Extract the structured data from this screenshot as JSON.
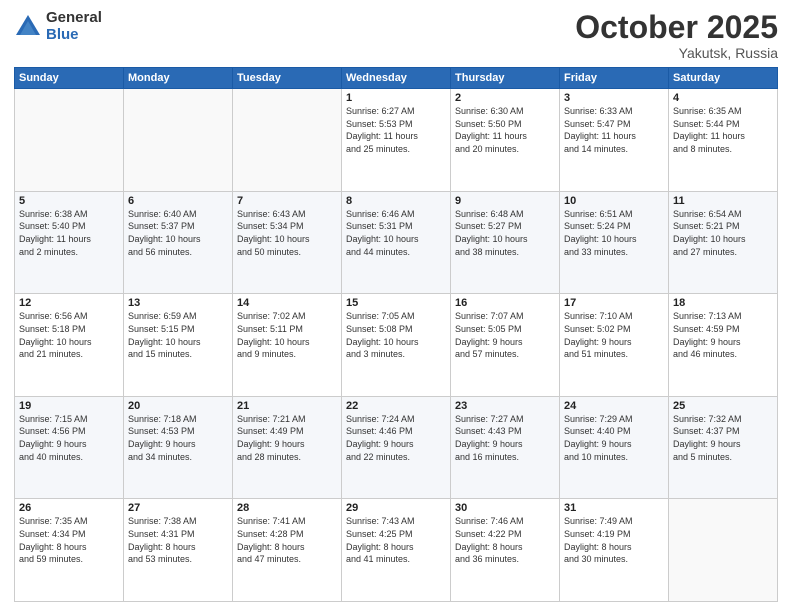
{
  "header": {
    "logo_general": "General",
    "logo_blue": "Blue",
    "month": "October 2025",
    "location": "Yakutsk, Russia"
  },
  "days_of_week": [
    "Sunday",
    "Monday",
    "Tuesday",
    "Wednesday",
    "Thursday",
    "Friday",
    "Saturday"
  ],
  "weeks": [
    [
      {
        "day": "",
        "info": ""
      },
      {
        "day": "",
        "info": ""
      },
      {
        "day": "",
        "info": ""
      },
      {
        "day": "1",
        "info": "Sunrise: 6:27 AM\nSunset: 5:53 PM\nDaylight: 11 hours\nand 25 minutes."
      },
      {
        "day": "2",
        "info": "Sunrise: 6:30 AM\nSunset: 5:50 PM\nDaylight: 11 hours\nand 20 minutes."
      },
      {
        "day": "3",
        "info": "Sunrise: 6:33 AM\nSunset: 5:47 PM\nDaylight: 11 hours\nand 14 minutes."
      },
      {
        "day": "4",
        "info": "Sunrise: 6:35 AM\nSunset: 5:44 PM\nDaylight: 11 hours\nand 8 minutes."
      }
    ],
    [
      {
        "day": "5",
        "info": "Sunrise: 6:38 AM\nSunset: 5:40 PM\nDaylight: 11 hours\nand 2 minutes."
      },
      {
        "day": "6",
        "info": "Sunrise: 6:40 AM\nSunset: 5:37 PM\nDaylight: 10 hours\nand 56 minutes."
      },
      {
        "day": "7",
        "info": "Sunrise: 6:43 AM\nSunset: 5:34 PM\nDaylight: 10 hours\nand 50 minutes."
      },
      {
        "day": "8",
        "info": "Sunrise: 6:46 AM\nSunset: 5:31 PM\nDaylight: 10 hours\nand 44 minutes."
      },
      {
        "day": "9",
        "info": "Sunrise: 6:48 AM\nSunset: 5:27 PM\nDaylight: 10 hours\nand 38 minutes."
      },
      {
        "day": "10",
        "info": "Sunrise: 6:51 AM\nSunset: 5:24 PM\nDaylight: 10 hours\nand 33 minutes."
      },
      {
        "day": "11",
        "info": "Sunrise: 6:54 AM\nSunset: 5:21 PM\nDaylight: 10 hours\nand 27 minutes."
      }
    ],
    [
      {
        "day": "12",
        "info": "Sunrise: 6:56 AM\nSunset: 5:18 PM\nDaylight: 10 hours\nand 21 minutes."
      },
      {
        "day": "13",
        "info": "Sunrise: 6:59 AM\nSunset: 5:15 PM\nDaylight: 10 hours\nand 15 minutes."
      },
      {
        "day": "14",
        "info": "Sunrise: 7:02 AM\nSunset: 5:11 PM\nDaylight: 10 hours\nand 9 minutes."
      },
      {
        "day": "15",
        "info": "Sunrise: 7:05 AM\nSunset: 5:08 PM\nDaylight: 10 hours\nand 3 minutes."
      },
      {
        "day": "16",
        "info": "Sunrise: 7:07 AM\nSunset: 5:05 PM\nDaylight: 9 hours\nand 57 minutes."
      },
      {
        "day": "17",
        "info": "Sunrise: 7:10 AM\nSunset: 5:02 PM\nDaylight: 9 hours\nand 51 minutes."
      },
      {
        "day": "18",
        "info": "Sunrise: 7:13 AM\nSunset: 4:59 PM\nDaylight: 9 hours\nand 46 minutes."
      }
    ],
    [
      {
        "day": "19",
        "info": "Sunrise: 7:15 AM\nSunset: 4:56 PM\nDaylight: 9 hours\nand 40 minutes."
      },
      {
        "day": "20",
        "info": "Sunrise: 7:18 AM\nSunset: 4:53 PM\nDaylight: 9 hours\nand 34 minutes."
      },
      {
        "day": "21",
        "info": "Sunrise: 7:21 AM\nSunset: 4:49 PM\nDaylight: 9 hours\nand 28 minutes."
      },
      {
        "day": "22",
        "info": "Sunrise: 7:24 AM\nSunset: 4:46 PM\nDaylight: 9 hours\nand 22 minutes."
      },
      {
        "day": "23",
        "info": "Sunrise: 7:27 AM\nSunset: 4:43 PM\nDaylight: 9 hours\nand 16 minutes."
      },
      {
        "day": "24",
        "info": "Sunrise: 7:29 AM\nSunset: 4:40 PM\nDaylight: 9 hours\nand 10 minutes."
      },
      {
        "day": "25",
        "info": "Sunrise: 7:32 AM\nSunset: 4:37 PM\nDaylight: 9 hours\nand 5 minutes."
      }
    ],
    [
      {
        "day": "26",
        "info": "Sunrise: 7:35 AM\nSunset: 4:34 PM\nDaylight: 8 hours\nand 59 minutes."
      },
      {
        "day": "27",
        "info": "Sunrise: 7:38 AM\nSunset: 4:31 PM\nDaylight: 8 hours\nand 53 minutes."
      },
      {
        "day": "28",
        "info": "Sunrise: 7:41 AM\nSunset: 4:28 PM\nDaylight: 8 hours\nand 47 minutes."
      },
      {
        "day": "29",
        "info": "Sunrise: 7:43 AM\nSunset: 4:25 PM\nDaylight: 8 hours\nand 41 minutes."
      },
      {
        "day": "30",
        "info": "Sunrise: 7:46 AM\nSunset: 4:22 PM\nDaylight: 8 hours\nand 36 minutes."
      },
      {
        "day": "31",
        "info": "Sunrise: 7:49 AM\nSunset: 4:19 PM\nDaylight: 8 hours\nand 30 minutes."
      },
      {
        "day": "",
        "info": ""
      }
    ]
  ]
}
